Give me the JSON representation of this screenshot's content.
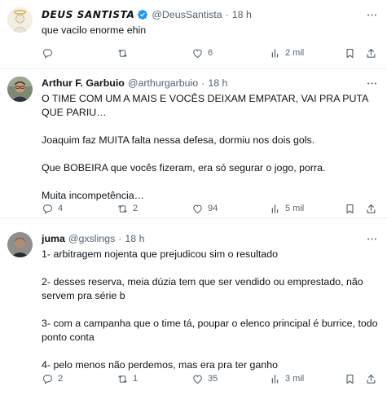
{
  "tweets": [
    {
      "display_name": "DEUS SANTISTA",
      "handle": "@DeusSantista",
      "separator": "·",
      "time": "18 h",
      "text": [
        "que vacilo enorme ehin"
      ],
      "replies": "",
      "retweets": "",
      "likes": "6",
      "views": "2 mil",
      "verified": true
    },
    {
      "display_name": "Arthur F. Garbuio",
      "handle": "@arthurgarbuio",
      "separator": "·",
      "time": "18 h",
      "text": [
        "O TIME COM UM A MAIS E VOCÊS DEIXAM EMPATAR, VAI PRA PUTA QUE PARIU…",
        "Joaquim faz MUITA falta nessa defesa, dormiu nos dois gols.",
        "Que BOBEIRA que vocês fizeram, era só segurar o jogo, porra.",
        "Muita incompetência…"
      ],
      "replies": "4",
      "retweets": "2",
      "likes": "94",
      "views": "5 mil",
      "verified": false
    },
    {
      "display_name": "juma",
      "handle": "@gxslings",
      "separator": "·",
      "time": "18 h",
      "text": [
        "1- arbitragem nojenta que prejudicou sim o resultado",
        "2- desses reserva, meia dúzia tem que ser vendido ou emprestado, não servem pra série b",
        "3- com a campanha que o time tá, poupar o elenco principal é burrice, todo ponto conta",
        "4- pelo menos não perdemos, mas era pra ter ganho"
      ],
      "replies": "2",
      "retweets": "1",
      "likes": "35",
      "views": "3 mil",
      "verified": false
    }
  ],
  "colors": {
    "text_primary": "#0f1419",
    "text_secondary": "#536471",
    "verified_blue": "#1d9bf0",
    "divider": "#eff3f4"
  },
  "icons": [
    "reply-icon",
    "retweet-icon",
    "like-icon",
    "views-icon",
    "bookmark-icon",
    "share-icon",
    "more-icon",
    "verified-badge-icon"
  ]
}
